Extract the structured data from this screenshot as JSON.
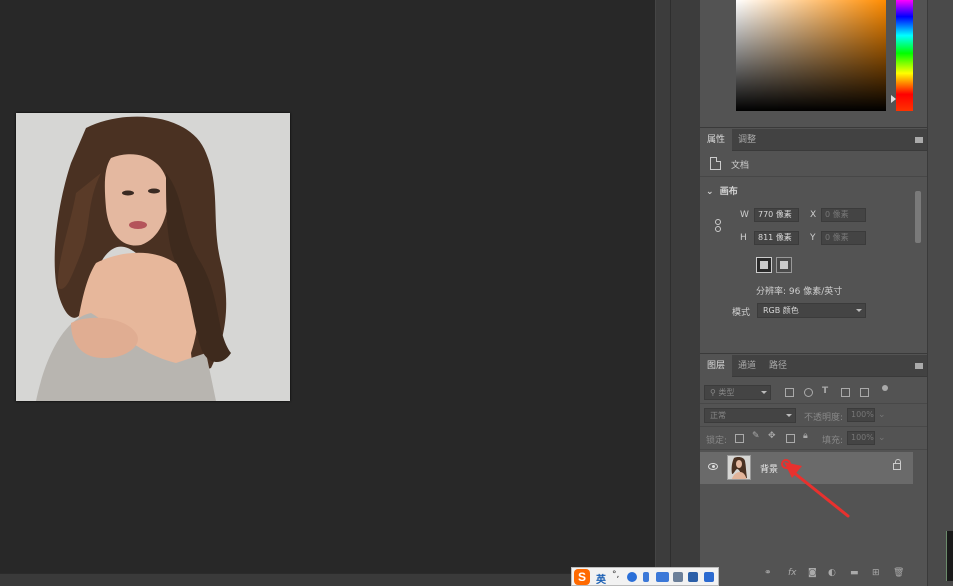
{
  "properties_panel": {
    "tabs": [
      "属性",
      "调整"
    ],
    "doc_label": "文档",
    "section_title": "画布",
    "width_label": "W",
    "width_value": "770 像素",
    "height_label": "H",
    "height_value": "811 像素",
    "x_label": "X",
    "x_placeholder": "0 像素",
    "y_label": "Y",
    "y_placeholder": "0 像素",
    "resolution": "分辨率: 96 像素/英寸",
    "mode_label": "模式",
    "mode_value": "RGB 颜色"
  },
  "layers_panel": {
    "tabs": [
      "图层",
      "通道",
      "路径"
    ],
    "filter_placeholder": "类型",
    "blend_mode": "正常",
    "opacity_label": "不透明度:",
    "opacity_value": "100%",
    "lock_label": "锁定:",
    "fill_label": "填充:",
    "fill_value": "100%",
    "layers": [
      {
        "name": "背景",
        "visible": true,
        "locked": true
      }
    ],
    "bottom_icons": [
      "link-icon",
      "fx-icon",
      "mask-icon",
      "adjustment-icon",
      "folder-icon",
      "new-layer-icon",
      "trash-icon"
    ]
  },
  "ime_bar": {
    "language": "英"
  },
  "colors": {
    "canvas_bg": "#282828",
    "panel_bg": "#535353",
    "selected_layer": "#6a6a6a",
    "annotation": "#e8312e"
  }
}
